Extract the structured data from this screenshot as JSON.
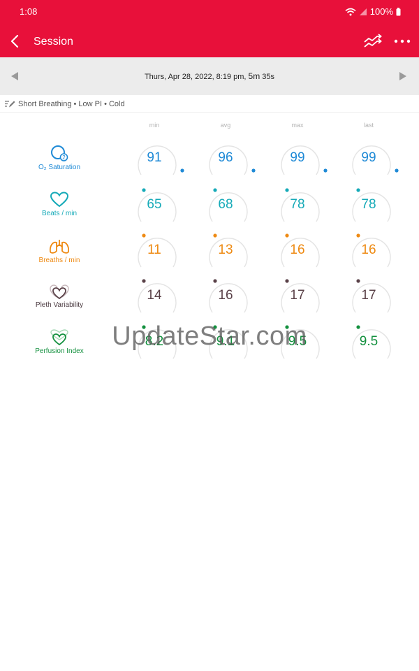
{
  "status_bar": {
    "time": "1:08",
    "battery": "100%"
  },
  "app_bar": {
    "title": "Session"
  },
  "session": {
    "date": "Thurs, Apr 28, 2022, 8:19 pm,",
    "duration_min": "5m",
    "duration_sec": "35s"
  },
  "tags": "Short Breathing • Low PI • Cold",
  "columns": [
    "min",
    "avg",
    "max",
    "last"
  ],
  "colors": {
    "red": "#e8103a",
    "blue": "#1f8ad6",
    "teal": "#16aab8",
    "orange": "#ee8a13",
    "plum": "#5a4148",
    "green": "#13903e"
  },
  "metrics": [
    {
      "label": "O₂ Saturation",
      "icon": "o2-icon",
      "color": "#1f8ad6",
      "values": [
        "91",
        "96",
        "99",
        "99"
      ]
    },
    {
      "label": "Beats / min",
      "icon": "heart-icon",
      "color": "#16aab8",
      "values": [
        "65",
        "68",
        "78",
        "78"
      ]
    },
    {
      "label": "Breaths / min",
      "icon": "lungs-icon",
      "color": "#ee8a13",
      "values": [
        "11",
        "13",
        "16",
        "16"
      ]
    },
    {
      "label": "Pleth Variability",
      "icon": "pleth-variability-icon",
      "color": "#5a4148",
      "values": [
        "14",
        "16",
        "17",
        "17"
      ]
    },
    {
      "label": "Perfusion Index",
      "icon": "perfusion-index-icon",
      "color": "#13903e",
      "values": [
        "8.2",
        "9.1",
        "9.5",
        "9.5"
      ]
    }
  ],
  "watermark": "UpdateStar.com"
}
